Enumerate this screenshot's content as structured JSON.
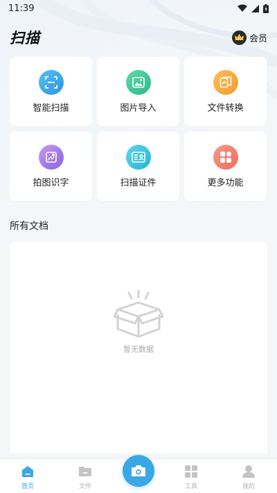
{
  "status_bar": {
    "time": "11:39"
  },
  "header": {
    "title": "扫描",
    "vip_label": "会员"
  },
  "tools": [
    {
      "label": "智能扫描",
      "icon": "smart-scan-icon",
      "color": "#3aa7e6"
    },
    {
      "label": "图片导入",
      "icon": "image-import-icon",
      "color": "#3cc49a"
    },
    {
      "label": "文件转换",
      "icon": "file-convert-icon",
      "color": "#f5a53a"
    },
    {
      "label": "拍图识字",
      "icon": "photo-ocr-icon",
      "color": "#a77be8"
    },
    {
      "label": "扫描证件",
      "icon": "id-scan-icon",
      "color": "#35c2e0"
    },
    {
      "label": "更多功能",
      "icon": "more-functions-icon",
      "color": "#f47c6c"
    }
  ],
  "section": {
    "title": "所有文档"
  },
  "empty_state": {
    "text": "暂无数据",
    "icon": "empty-box-icon"
  },
  "tabbar": {
    "items": [
      {
        "label": "首页",
        "icon": "home-icon",
        "active": true
      },
      {
        "label": "文件",
        "icon": "folder-icon",
        "active": false
      },
      {
        "label": "",
        "icon": "camera-icon",
        "active": false
      },
      {
        "label": "工具",
        "icon": "tools-grid-icon",
        "active": false
      },
      {
        "label": "我的",
        "icon": "profile-icon",
        "active": false
      }
    ]
  },
  "colors": {
    "accent": "#3aa7e6",
    "inactive": "#b0b0b0",
    "background": "#f4f6f8"
  }
}
